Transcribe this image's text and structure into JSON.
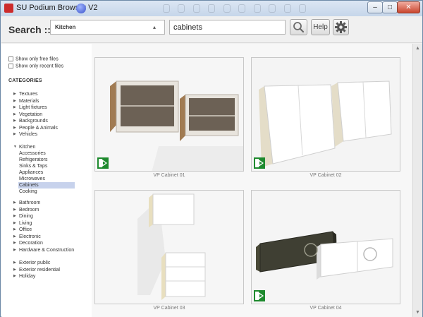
{
  "window": {
    "title": "SU Podium Browser V2",
    "buttons": {
      "minimize": "–",
      "maximize": "□",
      "close": "✕"
    }
  },
  "search": {
    "label": "Search ::",
    "category_selected": "Kitchen",
    "query": "cabinets",
    "help_label": "Help",
    "icons": {
      "search": "magnifier-icon",
      "settings": "gear-icon"
    }
  },
  "filters": {
    "free_files": "Show only free files",
    "recent_files": "Show only recent files"
  },
  "categories": {
    "heading": "CATEGORIES",
    "group1": [
      "Textures",
      "Materials",
      "Light fixtures",
      "Vegetation",
      "Backgrounds",
      "People & Animals",
      "Vehicles"
    ],
    "kitchen": {
      "label": "Kitchen",
      "children": [
        "Accessories",
        "Refrigerators",
        "Sinks & Taps",
        "Appliances",
        "Microwaves",
        "Cabinets",
        "Cooking"
      ],
      "selected": "Cabinets"
    },
    "group2": [
      "Bathroom",
      "Bedroom",
      "Dining",
      "Living",
      "Office",
      "Electronic",
      "Decoration",
      "Hardware & Construction"
    ],
    "group3": [
      "Exterior public",
      "Exterior residential",
      "Holiday"
    ]
  },
  "gallery": {
    "items": [
      {
        "label": "VP Cabinet 01"
      },
      {
        "label": "VP Cabinet 02"
      },
      {
        "label": "VP Cabinet 03"
      },
      {
        "label": "VP Cabinet 04"
      }
    ]
  },
  "colors": {
    "accent_green": "#1e8a2e",
    "selection": "#c7d2ec",
    "titlebar": "#c6d6ea"
  }
}
